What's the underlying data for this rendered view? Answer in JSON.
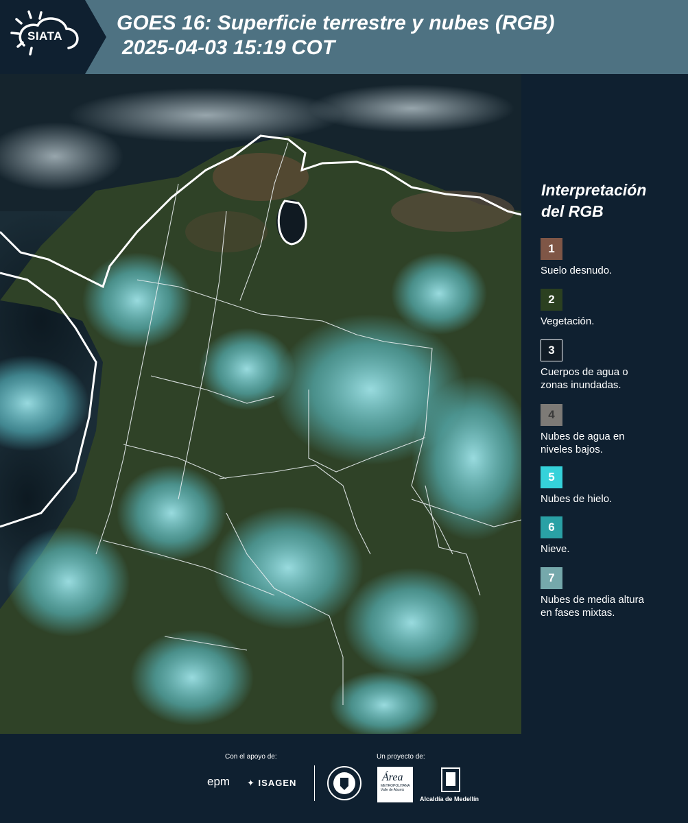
{
  "header": {
    "logo_text": "SIATA",
    "title_line1": "GOES 16: Superficie terrestre y nubes (RGB)",
    "title_line2": "2025-04-03 15:19 COT"
  },
  "map": {
    "icon": "satellite-map-image"
  },
  "legend": {
    "title_line1": "Interpretación",
    "title_line2": "del RGB",
    "items": [
      {
        "number": "1",
        "color": "#7f5646",
        "label_line1": "Suelo desnudo.",
        "label_line2": ""
      },
      {
        "number": "2",
        "color": "#2b4020",
        "label_line1": "Vegetación.",
        "label_line2": ""
      },
      {
        "number": "3",
        "color": "#111c26",
        "label_line1": "Cuerpos de agua o",
        "label_line2": "zonas inundadas."
      },
      {
        "number": "4",
        "color": "#7d7a76",
        "label_line1": "Nubes de agua en",
        "label_line2": "niveles bajos."
      },
      {
        "number": "5",
        "color": "#35d2da",
        "label_line1": "Nubes de hielo.",
        "label_line2": ""
      },
      {
        "number": "6",
        "color": "#2aa1a5",
        "label_line1": "Nieve.",
        "label_line2": ""
      },
      {
        "number": "7",
        "color": "#75a8ab",
        "label_line1": "Nubes de media altura",
        "label_line2": "en fases mixtas."
      }
    ]
  },
  "footer": {
    "support_label": "Con el apoyo de:",
    "project_label": "Un proyecto de:",
    "epm_logo": "epm",
    "isagen_logo": "ISAGEN",
    "area_logo_line1": "METROPOLITANA",
    "area_logo_line2": "Valle de Aburrá",
    "alcaldia_logo": "Alcaldía de Medellín"
  }
}
